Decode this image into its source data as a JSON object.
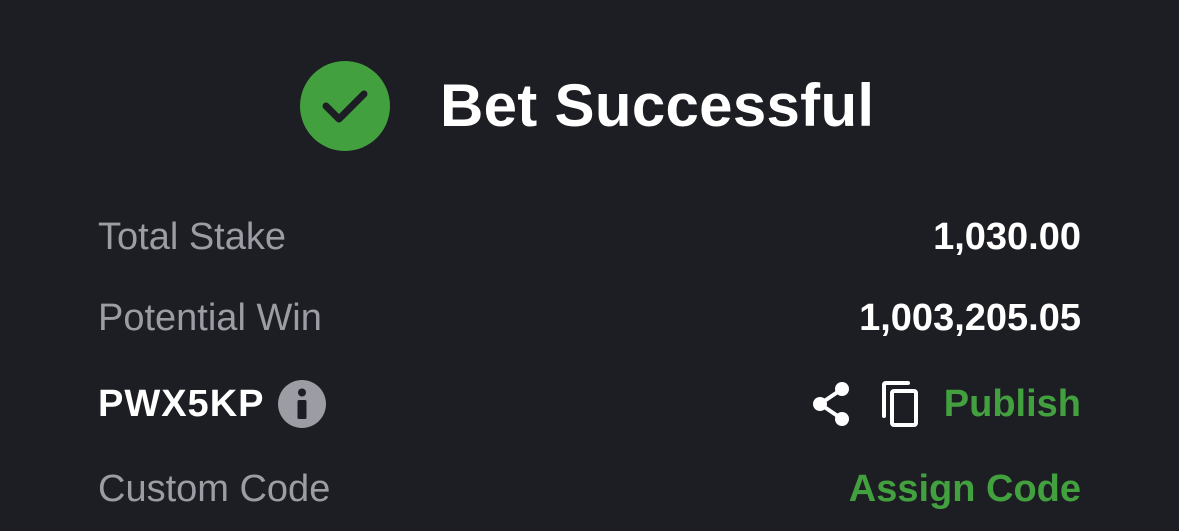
{
  "header": {
    "title": "Bet Successful",
    "icon": "check-circle-icon",
    "icon_color": "#43a03f"
  },
  "summary": {
    "total_stake": {
      "label": "Total Stake",
      "value": "1,030.00"
    },
    "potential_win": {
      "label": "Potential Win",
      "value": "1,003,205.05"
    }
  },
  "booking": {
    "code": "PWX5KP",
    "info_icon": "info-icon",
    "share_icon": "share-icon",
    "copy_icon": "copy-icon",
    "publish_label": "Publish"
  },
  "custom_code": {
    "label": "Custom Code",
    "action_label": "Assign Code"
  },
  "colors": {
    "background": "#1d1e23",
    "accent": "#43a03f",
    "muted_text": "#9b9ca4",
    "primary_text": "#ffffff"
  }
}
